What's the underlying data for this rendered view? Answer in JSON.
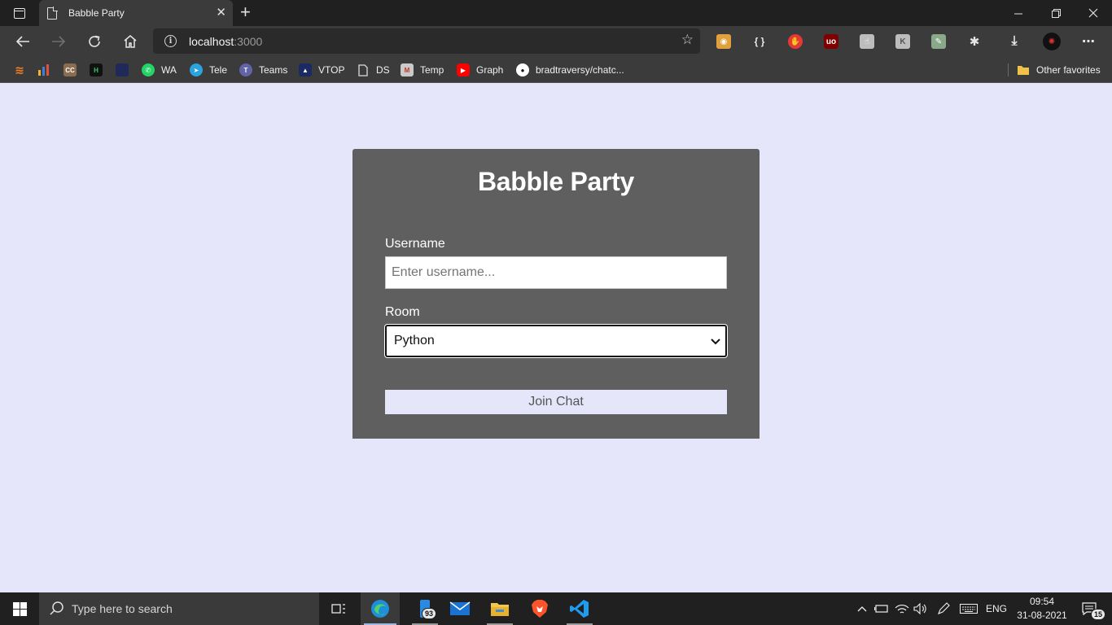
{
  "browser": {
    "tab": {
      "title": "Babble Party"
    },
    "address": {
      "host": "localhost",
      "port": ":3000"
    },
    "bookmarks": [
      {
        "label": "",
        "icon": "stackoverflow-icon",
        "color": "#f48024"
      },
      {
        "label": "",
        "icon": "chart-icon",
        "color": "#3f7fd6"
      },
      {
        "label": "",
        "icon": "cc-icon",
        "color": "#8a6d4e"
      },
      {
        "label": "",
        "icon": "hackerrank-icon",
        "color": "#111111"
      },
      {
        "label": "",
        "icon": "site-icon",
        "color": "#1f2a5a"
      },
      {
        "label": "WA",
        "icon": "whatsapp-icon",
        "color": "#25d366"
      },
      {
        "label": "Tele",
        "icon": "telegram-icon",
        "color": "#2aa3df"
      },
      {
        "label": "Teams",
        "icon": "teams-icon",
        "color": "#6264a7"
      },
      {
        "label": "VTOP",
        "icon": "vtop-icon",
        "color": "#1b2a63"
      },
      {
        "label": "DS",
        "icon": "page-icon",
        "color": "#3b3b3b"
      },
      {
        "label": "Temp",
        "icon": "gmail-icon",
        "color": "#c9c9c9"
      },
      {
        "label": "Graph",
        "icon": "youtube-icon",
        "color": "#ff0000"
      },
      {
        "label": "bradtraversy/chatc...",
        "icon": "github-icon",
        "color": "#ffffff"
      }
    ],
    "other_favorites": "Other favorites"
  },
  "app": {
    "title": "Babble Party",
    "username_label": "Username",
    "username_placeholder": "Enter username...",
    "room_label": "Room",
    "room_selected": "Python",
    "join_label": "Join Chat"
  },
  "taskbar": {
    "search_placeholder": "Type here to search",
    "files_badge": "93",
    "language": "ENG",
    "time": "09:54",
    "date": "31-08-2021",
    "notifications": "15"
  }
}
